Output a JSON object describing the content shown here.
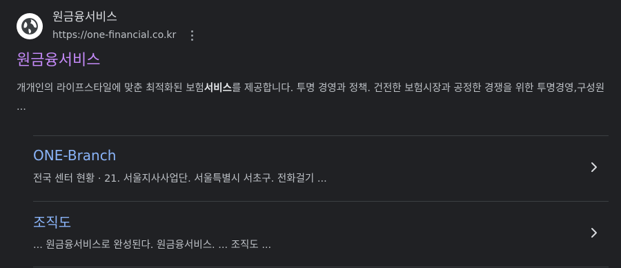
{
  "site": {
    "name": "원금융서비스",
    "url": "https://one-financial.co.kr",
    "favicon_icon": "globe-icon"
  },
  "result": {
    "title": "원금융서비스",
    "snippet_before": "개개인의 라이프스타일에 맞춘 최적화된 보험",
    "snippet_bold": "서비스",
    "snippet_after": "를 제공합니다. 투명 경영과 정책. 건전한 보험시장과 공정한 경쟁을 위한 투명경영,구성원 ..."
  },
  "sitelinks": [
    {
      "title": "ONE-Branch",
      "description": "전국 센터 현황 · 21. 서울지사사업단. 서울특별시 서초구. 전화걸기 ..."
    },
    {
      "title": "조직도",
      "description": "... 원금융서비스로 완성된다. 원금융서비스. ... 조직도 ..."
    }
  ],
  "colors": {
    "background": "#202124",
    "visited_title": "#c58af9",
    "link_title": "#8ab4f8",
    "text": "#bdc1c6",
    "divider": "#3c4043"
  },
  "icons": {
    "menu": "more-vert-icon",
    "chevron": "chevron-right-icon"
  }
}
